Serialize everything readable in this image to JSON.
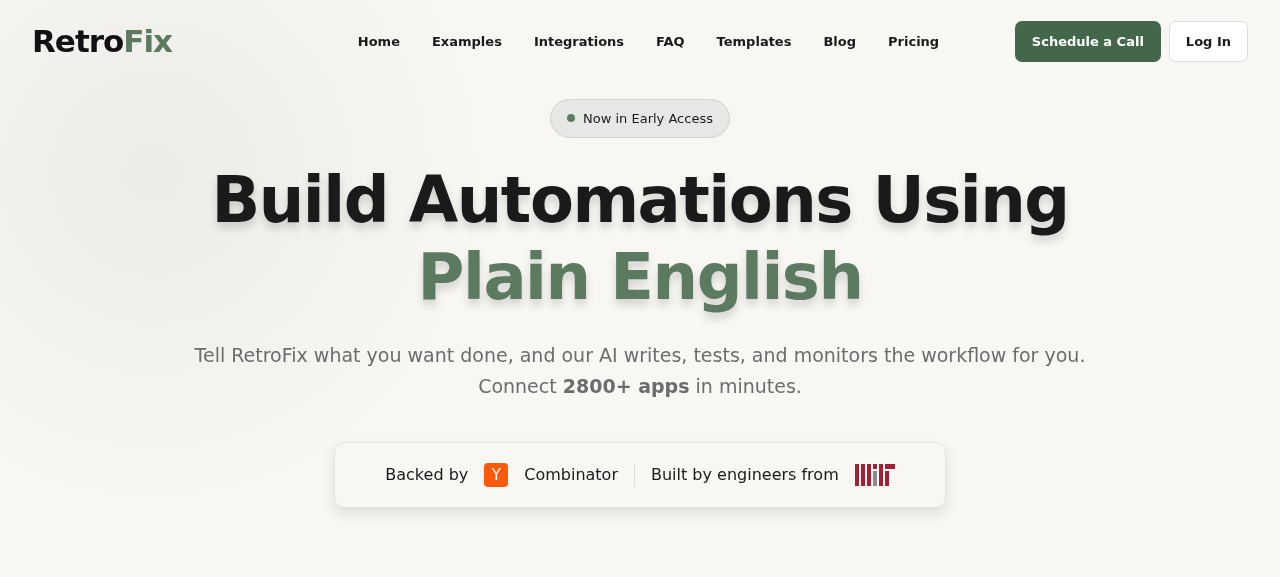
{
  "brand": {
    "primary": "Retro",
    "accent": "Fix"
  },
  "nav": [
    {
      "label": "Home"
    },
    {
      "label": "Examples"
    },
    {
      "label": "Integrations"
    },
    {
      "label": "FAQ"
    },
    {
      "label": "Templates"
    },
    {
      "label": "Blog"
    },
    {
      "label": "Pricing"
    }
  ],
  "actions": {
    "primary": "Schedule a Call",
    "secondary": "Log In"
  },
  "hero": {
    "badge": "Now in Early Access",
    "title_start": "Build Automations Using ",
    "title_highlight": "Plain English",
    "subtitle": "Tell RetroFix what you want done, and our AI writes, tests, and monitors the workflow for you. Connect **2800+ apps** in minutes."
  },
  "trust": {
    "backed_text": "Backed by",
    "yc_letter": "Y",
    "yc_text": "Combinator",
    "built_text": "Built by engineers from"
  }
}
